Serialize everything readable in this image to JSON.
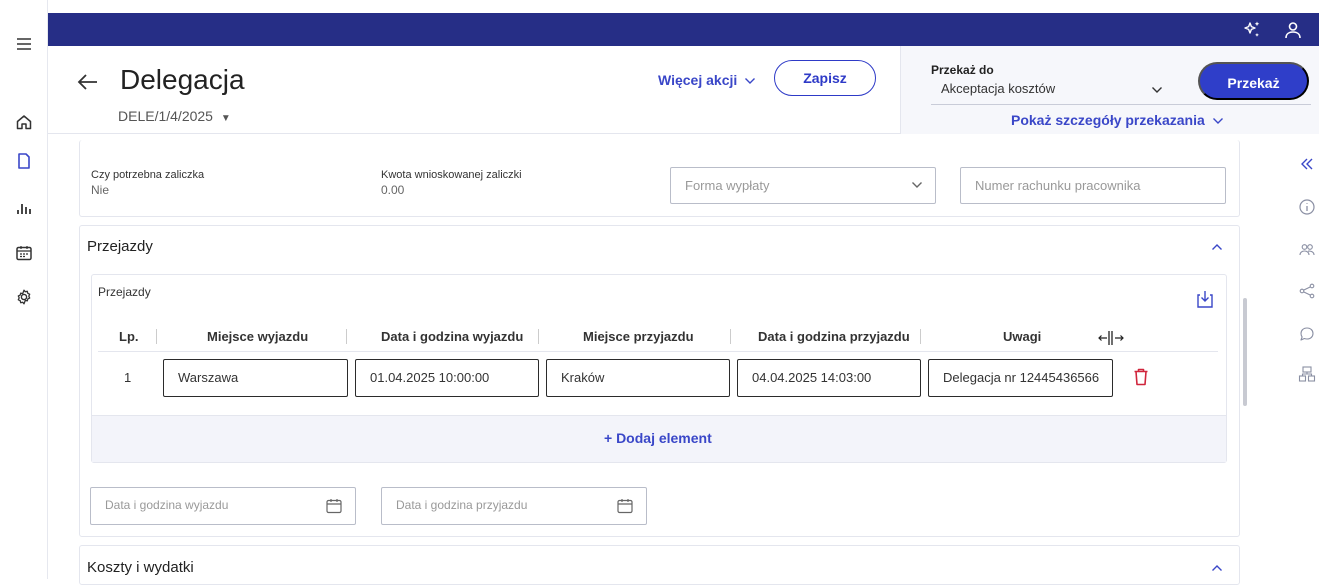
{
  "app": {
    "title": "Delegacja",
    "document_number": "DELE/1/4/2025"
  },
  "toolbar": {
    "more_actions": "Więcej akcji",
    "save": "Zapisz"
  },
  "handover": {
    "label": "Przekaż do",
    "selected": "Akceptacja kosztów",
    "button": "Przekaż",
    "details_link": "Pokaż szczegóły przekazania"
  },
  "advance": {
    "needed_label": "Czy potrzebna zaliczka",
    "needed_value": "Nie",
    "amount_label": "Kwota wnioskowanej zaliczki",
    "amount_value": "0.00",
    "payment_form_placeholder": "Forma wypłaty",
    "account_placeholder": "Numer rachunku pracownika"
  },
  "trips": {
    "section_title": "Przejazdy",
    "table_title": "Przejazdy",
    "columns": [
      "Lp.",
      "Miejsce wyjazdu",
      "Data i godzina wyjazdu",
      "Miejsce przyjazdu",
      "Data i godzina przyjazdu",
      "Uwagi"
    ],
    "rows": [
      {
        "lp": "1",
        "departure_place": "Warszawa",
        "departure_datetime": "01.04.2025 10:00:00",
        "arrival_place": "Kraków",
        "arrival_datetime": "04.04.2025 14:03:00",
        "notes": "Delegacja nr 12445436566"
      }
    ],
    "add_element": "+ Dodaj element",
    "filter_departure_placeholder": "Data i godzina wyjazdu",
    "filter_arrival_placeholder": "Data i godzina przyjazdu"
  },
  "costs": {
    "section_title": "Koszty i wydatki"
  },
  "icons": {
    "menu": "hamburger-icon",
    "home": "home-icon",
    "document": "document-icon",
    "chart": "bar-chart-icon",
    "calendar": "calendar-icon",
    "settings": "gear-icon",
    "sparkle": "sparkle-icon",
    "user": "user-icon"
  },
  "colors": {
    "topbar": "#262e86",
    "accent": "#2f3ec9",
    "delete": "#d0253c"
  }
}
